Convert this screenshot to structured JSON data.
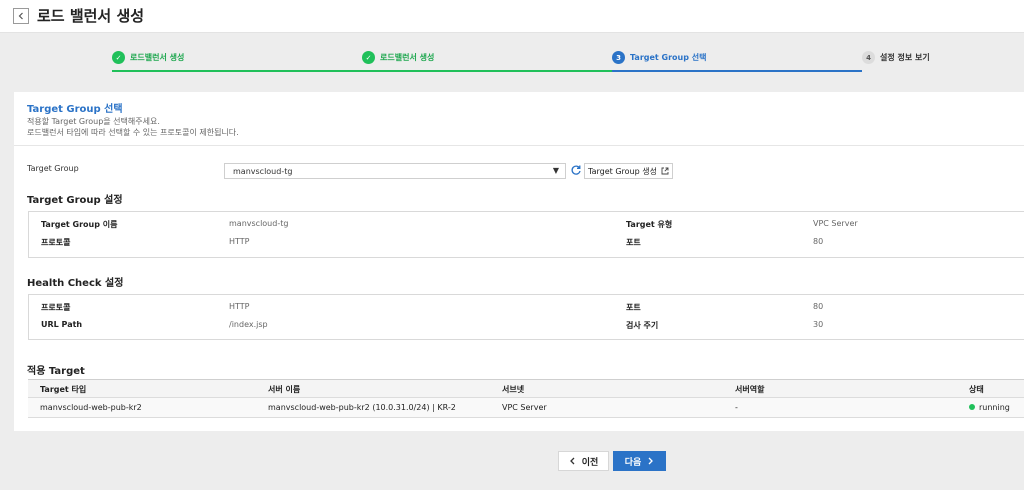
{
  "header": {
    "title": "로드 밸런서 생성"
  },
  "steps": [
    {
      "num": "1",
      "label": "로드밸런서 생성",
      "state": "done"
    },
    {
      "num": "2",
      "label": "로드밸런서 생성",
      "state": "done"
    },
    {
      "num": "3",
      "label": "Target Group 선택",
      "state": "active"
    },
    {
      "num": "4",
      "label": "설정 정보 보기",
      "state": "todo"
    }
  ],
  "section": {
    "title": "Target Group 선택",
    "desc1": "적용할 Target Group을 선택해주세요.",
    "desc2": "로드밸런서 타입에 따라 선택할 수 있는 프로토콜이 제한됩니다."
  },
  "target_group": {
    "label": "Target Group",
    "selected": "manvscloud-tg",
    "create_label": "Target Group 생성"
  },
  "tg_settings": {
    "title": "Target Group 설정",
    "name_key": "Target Group 이름",
    "name_val": "manvscloud-tg",
    "type_key": "Target 유형",
    "type_val": "VPC Server",
    "proto_key": "프로토콜",
    "proto_val": "HTTP",
    "port_key": "포트",
    "port_val": "80"
  },
  "health_check": {
    "title": "Health Check 설정",
    "proto_key": "프로토콜",
    "proto_val": "HTTP",
    "port_key": "포트",
    "port_val": "80",
    "path_key": "URL Path",
    "path_val": "/index.jsp",
    "interval_key": "검사 주기",
    "interval_val": "30"
  },
  "targets": {
    "title": "적용 Target",
    "columns": [
      "Target 타입",
      "서버 이름",
      "서브넷",
      "서버역할",
      "상태"
    ],
    "rows": [
      {
        "type": "manvscloud-web-pub-kr2",
        "server": "manvscloud-web-pub-kr2 (10.0.31.0/24) | KR-2",
        "subnet": "VPC Server",
        "role": "-",
        "status": "running",
        "status_color": "#20c05a"
      }
    ]
  },
  "buttons": {
    "prev": "이전",
    "next": "다음"
  },
  "colors": {
    "accent": "#2b73c7",
    "success": "#20c05a"
  }
}
